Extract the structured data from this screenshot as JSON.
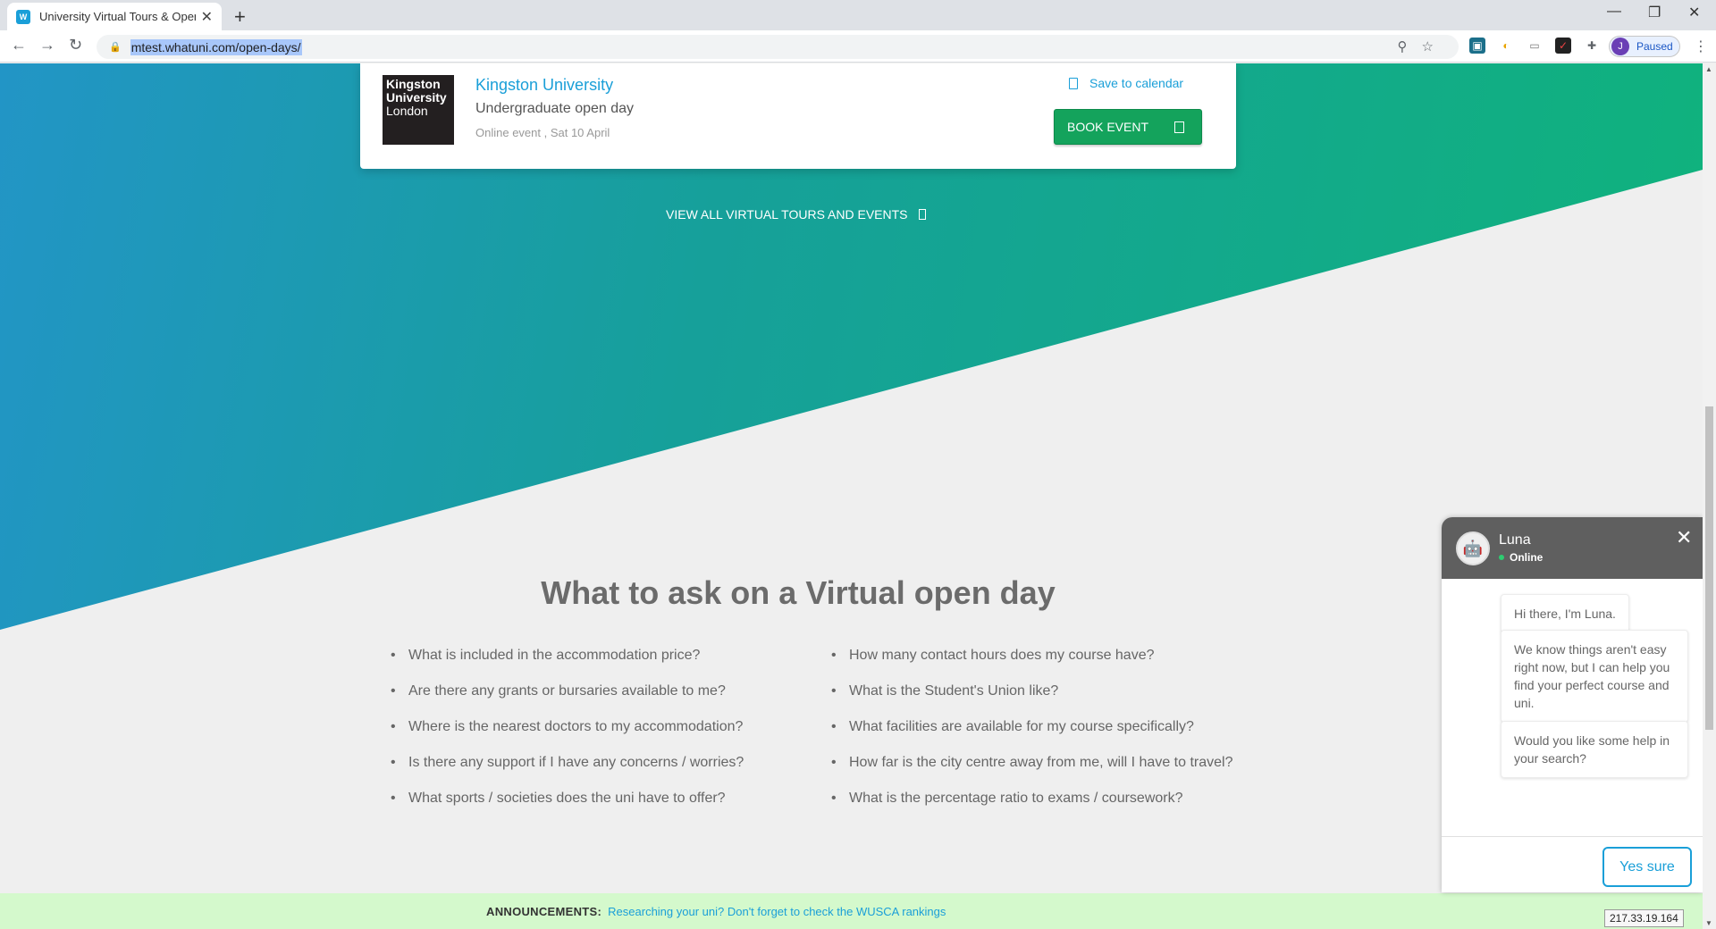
{
  "browser": {
    "tab_title": "University Virtual Tours & Open D",
    "favicon_text": "W",
    "url": "mtest.whatuni.com/open-days/",
    "profile_initial": "J",
    "profile_status": "Paused"
  },
  "event_card": {
    "logo_line1": "Kingston",
    "logo_line2": "University",
    "logo_line3": "London",
    "university": "Kingston University",
    "event_type": "Undergraduate open day",
    "event_meta": "Online event , Sat 10 April",
    "save_label": "Save to calendar",
    "book_label": "BOOK EVENT"
  },
  "view_all_label": "VIEW ALL VIRTUAL TOURS AND EVENTS",
  "questions": {
    "title": "What to ask on a Virtual open day",
    "left": [
      "What is included in the accommodation price?",
      "Are there any grants or bursaries available to me?",
      "Where is the nearest doctors to my accommodation?",
      "Is there any support if I have any concerns / worries?",
      "What sports / societies does the uni have to offer?"
    ],
    "right": [
      "How many contact hours does my course have?",
      "What is the Student's Union like?",
      "What facilities are available for my course specifically?",
      "How far is the city centre away from me, will I have to travel?",
      "What is the percentage ratio to exams / coursework?"
    ]
  },
  "announcement": {
    "label": "ANNOUNCEMENTS:",
    "message": "Researching your uni? Don't forget to check the WUSCA rankings"
  },
  "chat": {
    "name": "Luna",
    "status": "Online",
    "messages": [
      "Hi there, I'm Luna.",
      "We know things aren't easy right now, but I can help you find your perfect course and uni.",
      "Would you like some help in your search?"
    ],
    "reply_label": "Yes sure"
  },
  "ip_tooltip": "217.33.19.164",
  "colors": {
    "accent_blue": "#1a9fd8",
    "book_green": "#14a35c",
    "announce_bg": "#d4f9cc"
  }
}
